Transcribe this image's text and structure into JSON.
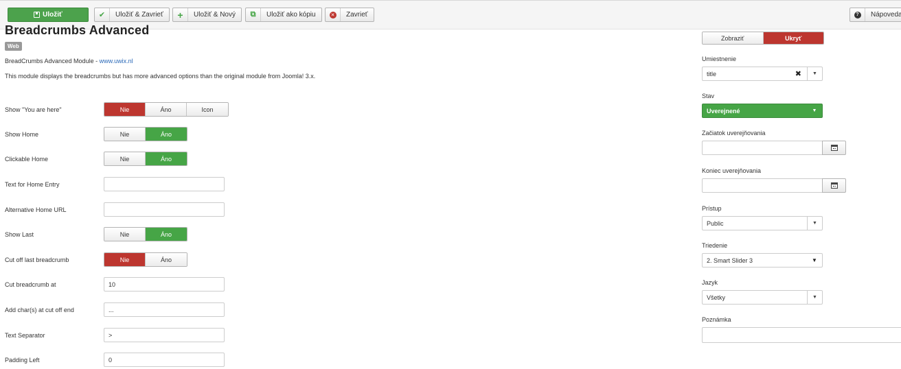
{
  "toolbar": {
    "save": "Uložiť",
    "save_close": "Uložiť & Zavrieť",
    "save_new": "Uložiť & Nový",
    "save_copy": "Uložiť ako kópiu",
    "close": "Zavrieť",
    "help": "Nápoveda"
  },
  "module": {
    "title": "Breadcrumbs Advanced",
    "tag": "Web",
    "desc_prefix": "BreadCrumbs Advanced Module - ",
    "desc_link": "www.uwix.nl",
    "desc2": "This module displays the breadcrumbs but has more advanced options than the original module from Joomla! 3.x."
  },
  "fields": {
    "show_you_are_here": {
      "label": "Show \"You are here\"",
      "options": [
        "Nie",
        "Áno",
        "Icon"
      ],
      "selected": "Nie"
    },
    "show_home": {
      "label": "Show Home",
      "options": [
        "Nie",
        "Áno"
      ],
      "selected": "Áno"
    },
    "clickable_home": {
      "label": "Clickable Home",
      "options": [
        "Nie",
        "Áno"
      ],
      "selected": "Áno"
    },
    "text_home_entry": {
      "label": "Text for Home Entry",
      "value": ""
    },
    "alt_home_url": {
      "label": "Alternative Home URL",
      "value": ""
    },
    "show_last": {
      "label": "Show Last",
      "options": [
        "Nie",
        "Áno"
      ],
      "selected": "Áno"
    },
    "cut_off_last": {
      "label": "Cut off last breadcrumb",
      "options": [
        "Nie",
        "Áno"
      ],
      "selected": "Nie"
    },
    "cut_at": {
      "label": "Cut breadcrumb at",
      "value": "10"
    },
    "add_chars": {
      "label": "Add char(s) at cut off end",
      "value": "..."
    },
    "separator": {
      "label": "Text Separator",
      "value": ">"
    },
    "padding_left": {
      "label": "Padding Left",
      "value": "0"
    }
  },
  "sidebar": {
    "title_toggle": {
      "options": [
        "Zobraziť",
        "Ukryť"
      ],
      "selected": "Ukryť"
    },
    "position": {
      "label": "Umiestnenie",
      "value": "title"
    },
    "status": {
      "label": "Stav",
      "value": "Uverejnené"
    },
    "publish_up": {
      "label": "Začiatok uverejňovania",
      "value": ""
    },
    "publish_down": {
      "label": "Koniec uverejňovania",
      "value": ""
    },
    "access": {
      "label": "Prístup",
      "value": "Public"
    },
    "ordering": {
      "label": "Triedenie",
      "value": "2. Smart Slider 3"
    },
    "language": {
      "label": "Jazyk",
      "value": "Všetky"
    },
    "note": {
      "label": "Poznámka",
      "value": ""
    }
  },
  "colors": {
    "success": "#46a546",
    "danger": "#bd362f",
    "link": "#2a69b8"
  }
}
